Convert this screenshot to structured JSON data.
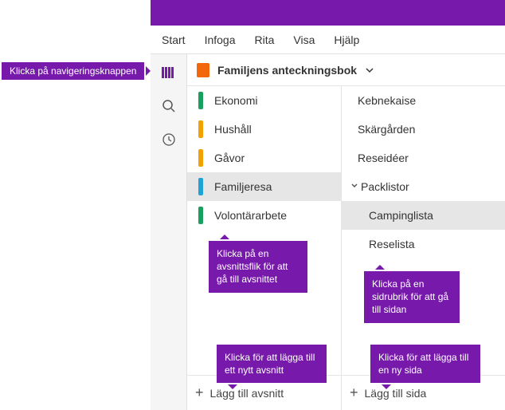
{
  "ribbon": {
    "tabs": [
      "Start",
      "Infoga",
      "Rita",
      "Visa",
      "Hjälp"
    ]
  },
  "tips": {
    "nav": "Klicka på navigeringsknappen",
    "section": "Klicka på en avsnittsflik för att gå till avsnittet",
    "page": "Klicka på en sidrubrik för att gå till sidan",
    "addSection": "Klicka för att lägga till ett nytt avsnitt",
    "addPage": "Klicka för att lägga till en ny sida"
  },
  "notebook": {
    "title": "Familjens anteckningsbok"
  },
  "sections": [
    {
      "label": "Ekonomi",
      "color": "#1aa05e"
    },
    {
      "label": "Hushåll",
      "color": "#f2a100"
    },
    {
      "label": "Gåvor",
      "color": "#f2a100"
    },
    {
      "label": "Familjeresa",
      "color": "#1fa2d6",
      "active": true
    },
    {
      "label": "Volontärarbete",
      "color": "#1aa05e"
    }
  ],
  "pages": [
    {
      "label": "Kebnekaise"
    },
    {
      "label": "Skärgården"
    },
    {
      "label": "Reseidéer"
    },
    {
      "label": "Packlistor",
      "parent": true
    },
    {
      "label": "Campinglista",
      "child": true,
      "active": true
    },
    {
      "label": "Reselista",
      "child": true
    }
  ],
  "footer": {
    "addSection": "Lägg till avsnitt",
    "addPage": "Lägg till sida"
  }
}
